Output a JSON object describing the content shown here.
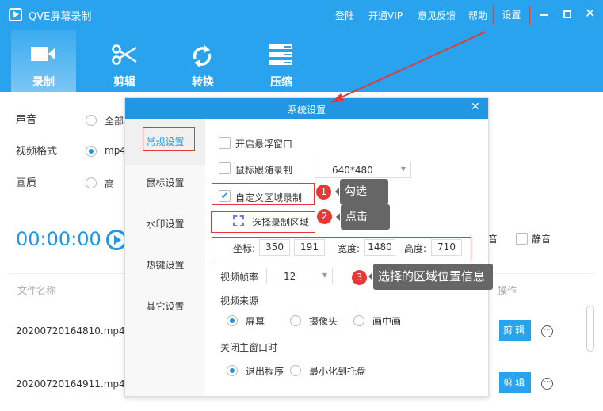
{
  "app": {
    "title": "QVE屏幕录制",
    "menu": [
      "登陆",
      "开通VIP",
      "意见反馈",
      "帮助",
      "设置"
    ]
  },
  "tabs": [
    {
      "label": "录制",
      "icon": "video-camera-icon"
    },
    {
      "label": "剪辑",
      "icon": "scissors-icon"
    },
    {
      "label": "转换",
      "icon": "refresh-icon"
    },
    {
      "label": "压缩",
      "icon": "compress-icon"
    }
  ],
  "main": {
    "sound_label": "声音",
    "sound_option": "全部",
    "format_label": "视频格式",
    "format_option": "mp4",
    "quality_label": "画质",
    "quality_option": "高",
    "timer": "00:00:00",
    "mute_partial": "音",
    "mute_label": "静音",
    "col_name": "文件名称",
    "col_ops": "操作",
    "files": [
      {
        "name": "20200720164810.mp4",
        "edit": "剪辑"
      },
      {
        "name": "20200720164911.mp4",
        "edit": "剪辑"
      }
    ]
  },
  "dialog": {
    "title": "系统设置",
    "nav": [
      "常规设置",
      "鼠标设置",
      "水印设置",
      "热键设置",
      "其它设置"
    ],
    "float_window": "开启悬浮窗口",
    "mouse_follow": "鼠标跟随录制",
    "mouse_follow_size": "640*480",
    "custom_region": "自定义区域录制",
    "select_region": "选择录制区域",
    "coord_label": "坐标:",
    "x": "350",
    "y": "191",
    "width_label": "宽度:",
    "width": "1480",
    "height_label": "高度:",
    "height": "710",
    "fps_label": "视频帧率",
    "fps": "12",
    "source_label": "视频来源",
    "sources": [
      "屏幕",
      "摄像头",
      "画中画"
    ],
    "close_label": "关闭主窗口时",
    "close_options": [
      "退出程序",
      "最小化到托盘"
    ]
  },
  "annotations": [
    {
      "num": "1",
      "text": "勾选"
    },
    {
      "num": "2",
      "text": "点击"
    },
    {
      "num": "3",
      "text": "选择的区域位置信息"
    }
  ],
  "colors": {
    "primary": "#2aa3ef",
    "dialog_header": "#2196e3",
    "annotation_red": "#e53935",
    "tooltip": "#666666"
  }
}
